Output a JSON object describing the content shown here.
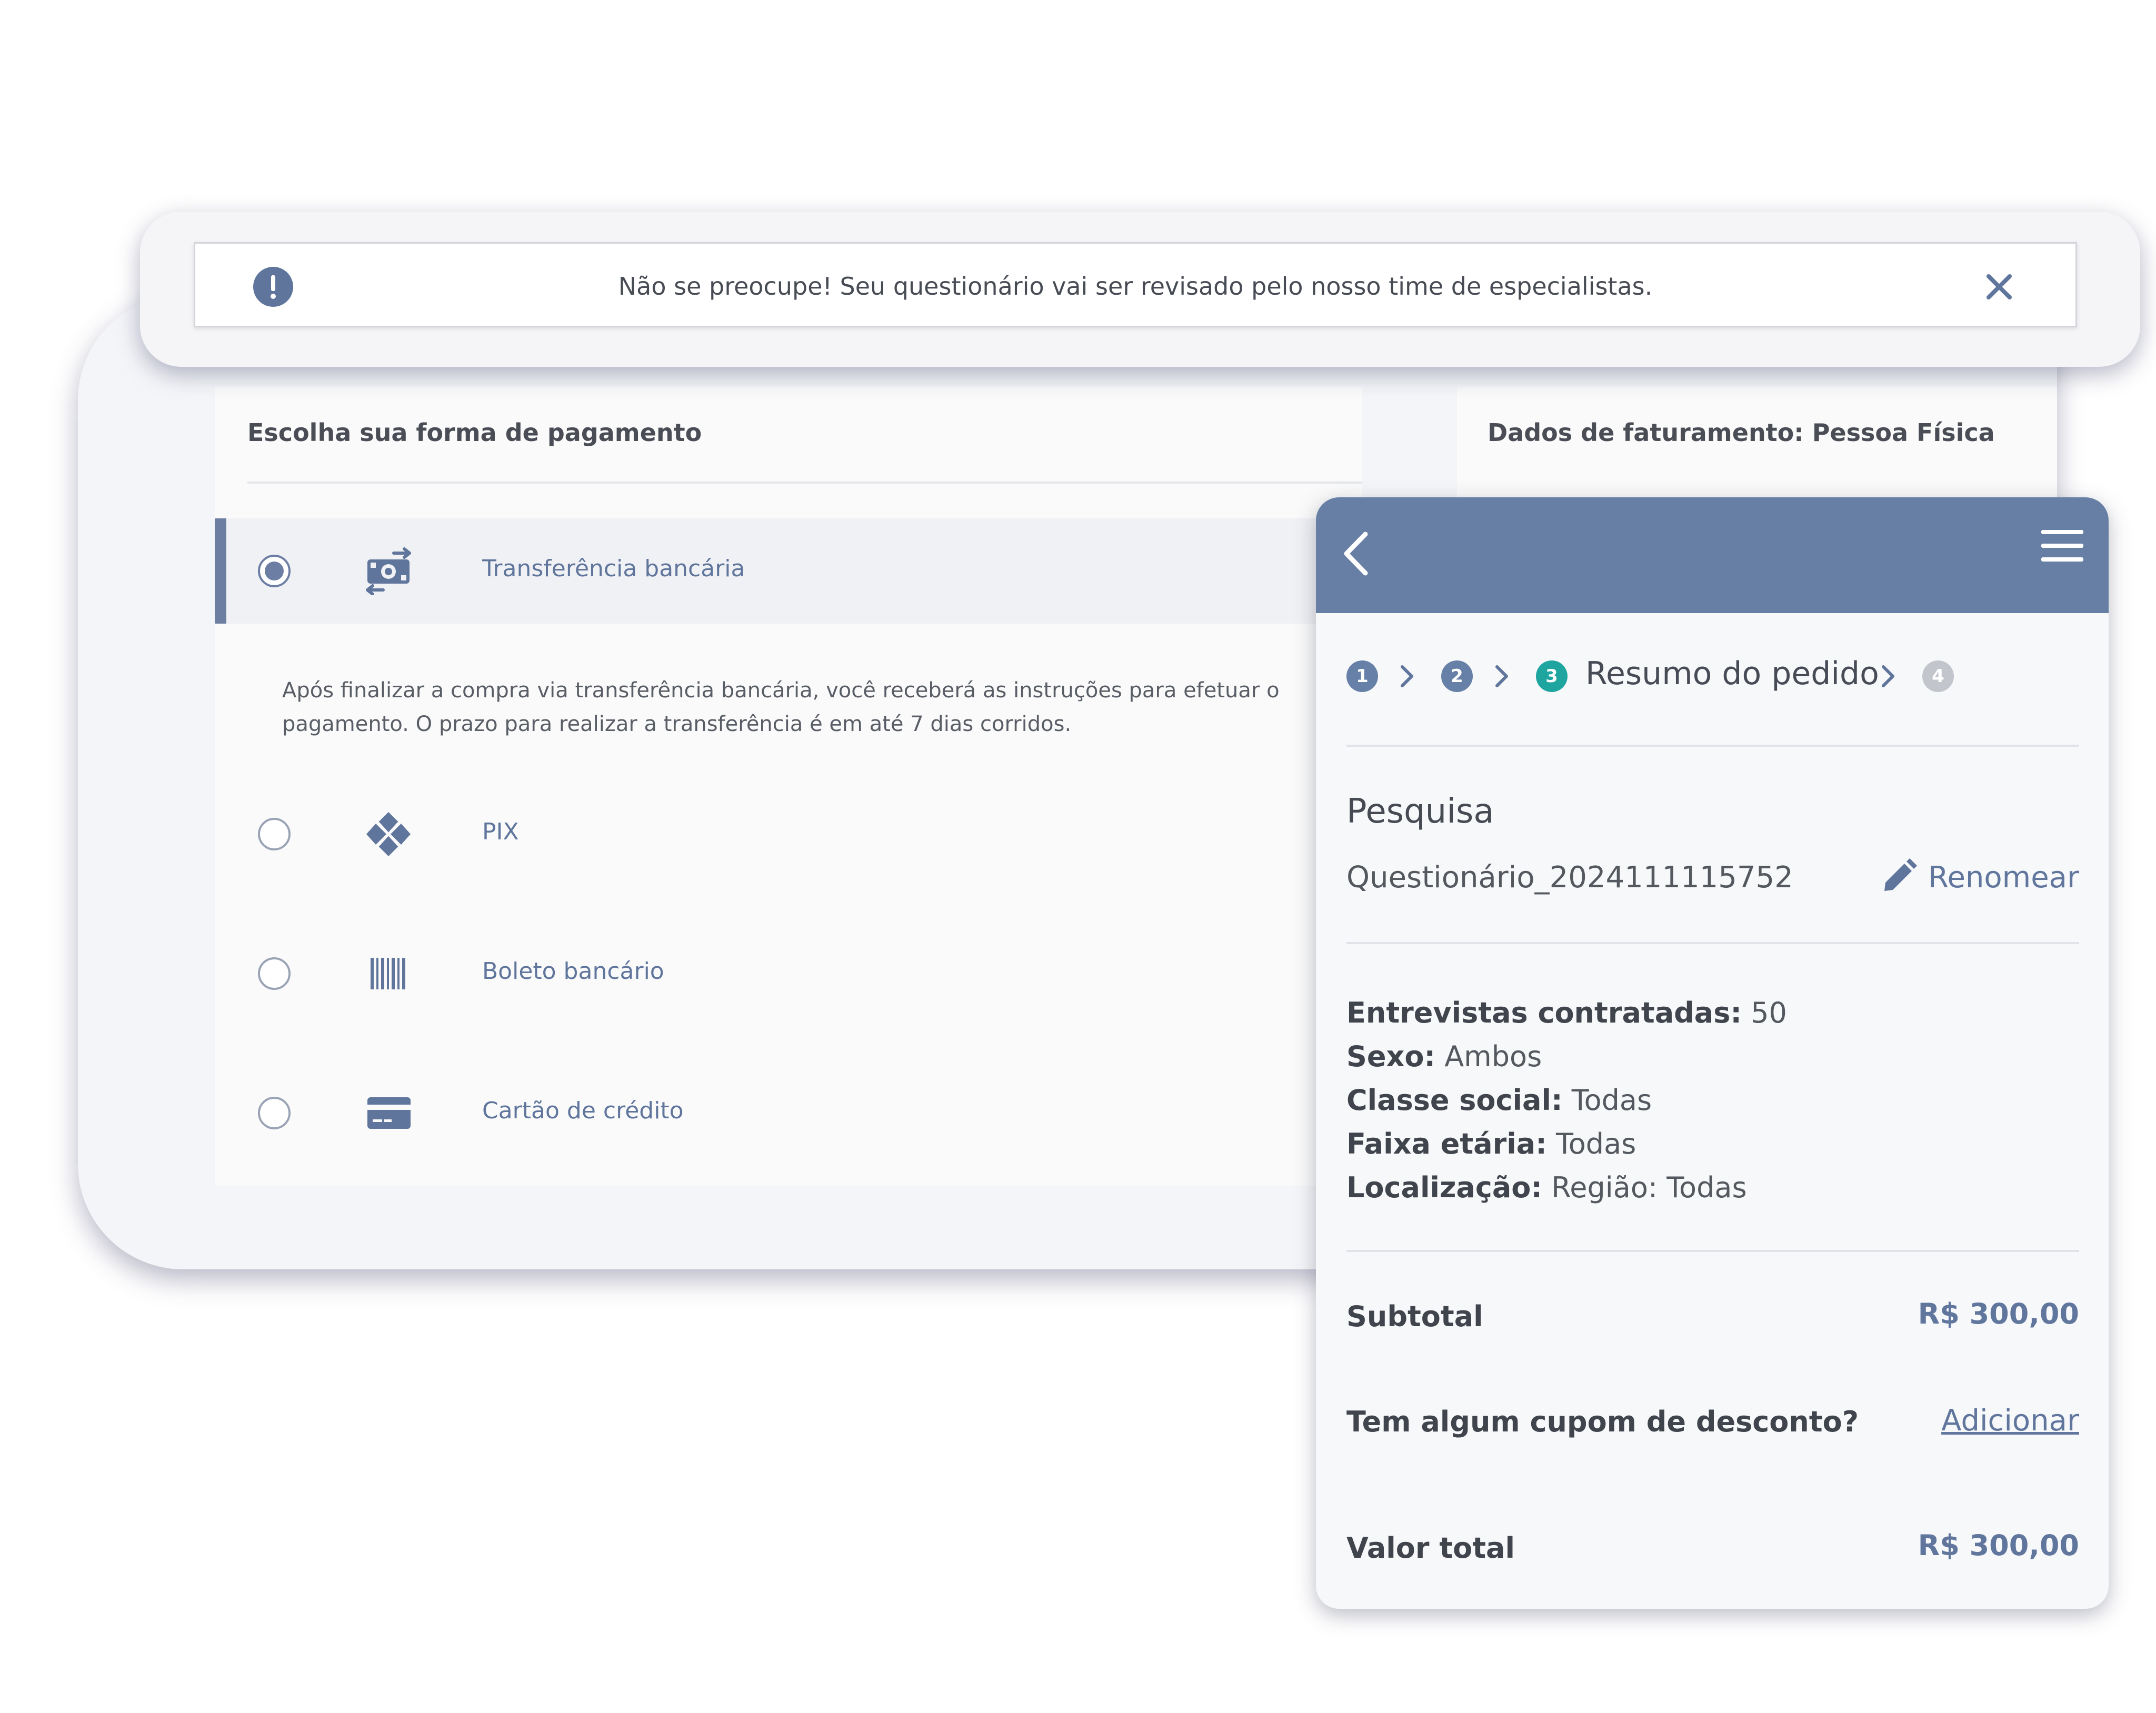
{
  "alert": {
    "message": "Não se preocupe! Seu questionário vai ser revisado pelo nosso time de especialistas.",
    "icon": "exclamation-circle-icon",
    "close_icon": "close-icon"
  },
  "payment": {
    "title": "Escolha sua forma de pagamento",
    "options": [
      {
        "label": "Transferência bancária",
        "icon": "money-transfer-icon",
        "selected": true
      },
      {
        "label": "PIX",
        "icon": "pix-icon",
        "selected": false
      },
      {
        "label": "Boleto bancário",
        "icon": "barcode-icon",
        "selected": false
      },
      {
        "label": "Cartão de crédito",
        "icon": "credit-card-icon",
        "selected": false
      }
    ],
    "transfer_description": "Após finalizar a compra via transferência bancária, você receberá as instruções para efetuar o pagamento. O prazo para realizar a transferência é em até 7 dias corridos."
  },
  "billing": {
    "title": "Dados de faturamento: Pessoa Física"
  },
  "summary": {
    "steps": [
      "1",
      "2",
      "3",
      "4"
    ],
    "current_step_label": "Resumo do pedido",
    "section_title": "Pesquisa",
    "questionnaire_name": "Questionário_2024111115752",
    "rename_label": "Renomear",
    "details": [
      {
        "key": "Entrevistas contratadas:",
        "value": " 50"
      },
      {
        "key": "Sexo:",
        "value": " Ambos"
      },
      {
        "key": "Classe social:",
        "value": " Todas"
      },
      {
        "key": "Faixa etária:",
        "value": " Todas"
      },
      {
        "key": "Localização:",
        "value": " Região: Todas"
      }
    ],
    "subtotal_label": "Subtotal",
    "subtotal_value": "R$ 300,00",
    "coupon_label": "Tem algum cupom de desconto?",
    "coupon_action": "Adicionar",
    "total_label": "Valor total",
    "total_value": "R$ 300,00"
  },
  "colors": {
    "accent": "#687fa5",
    "link": "#60769d",
    "active_step": "#1fa5a0"
  }
}
